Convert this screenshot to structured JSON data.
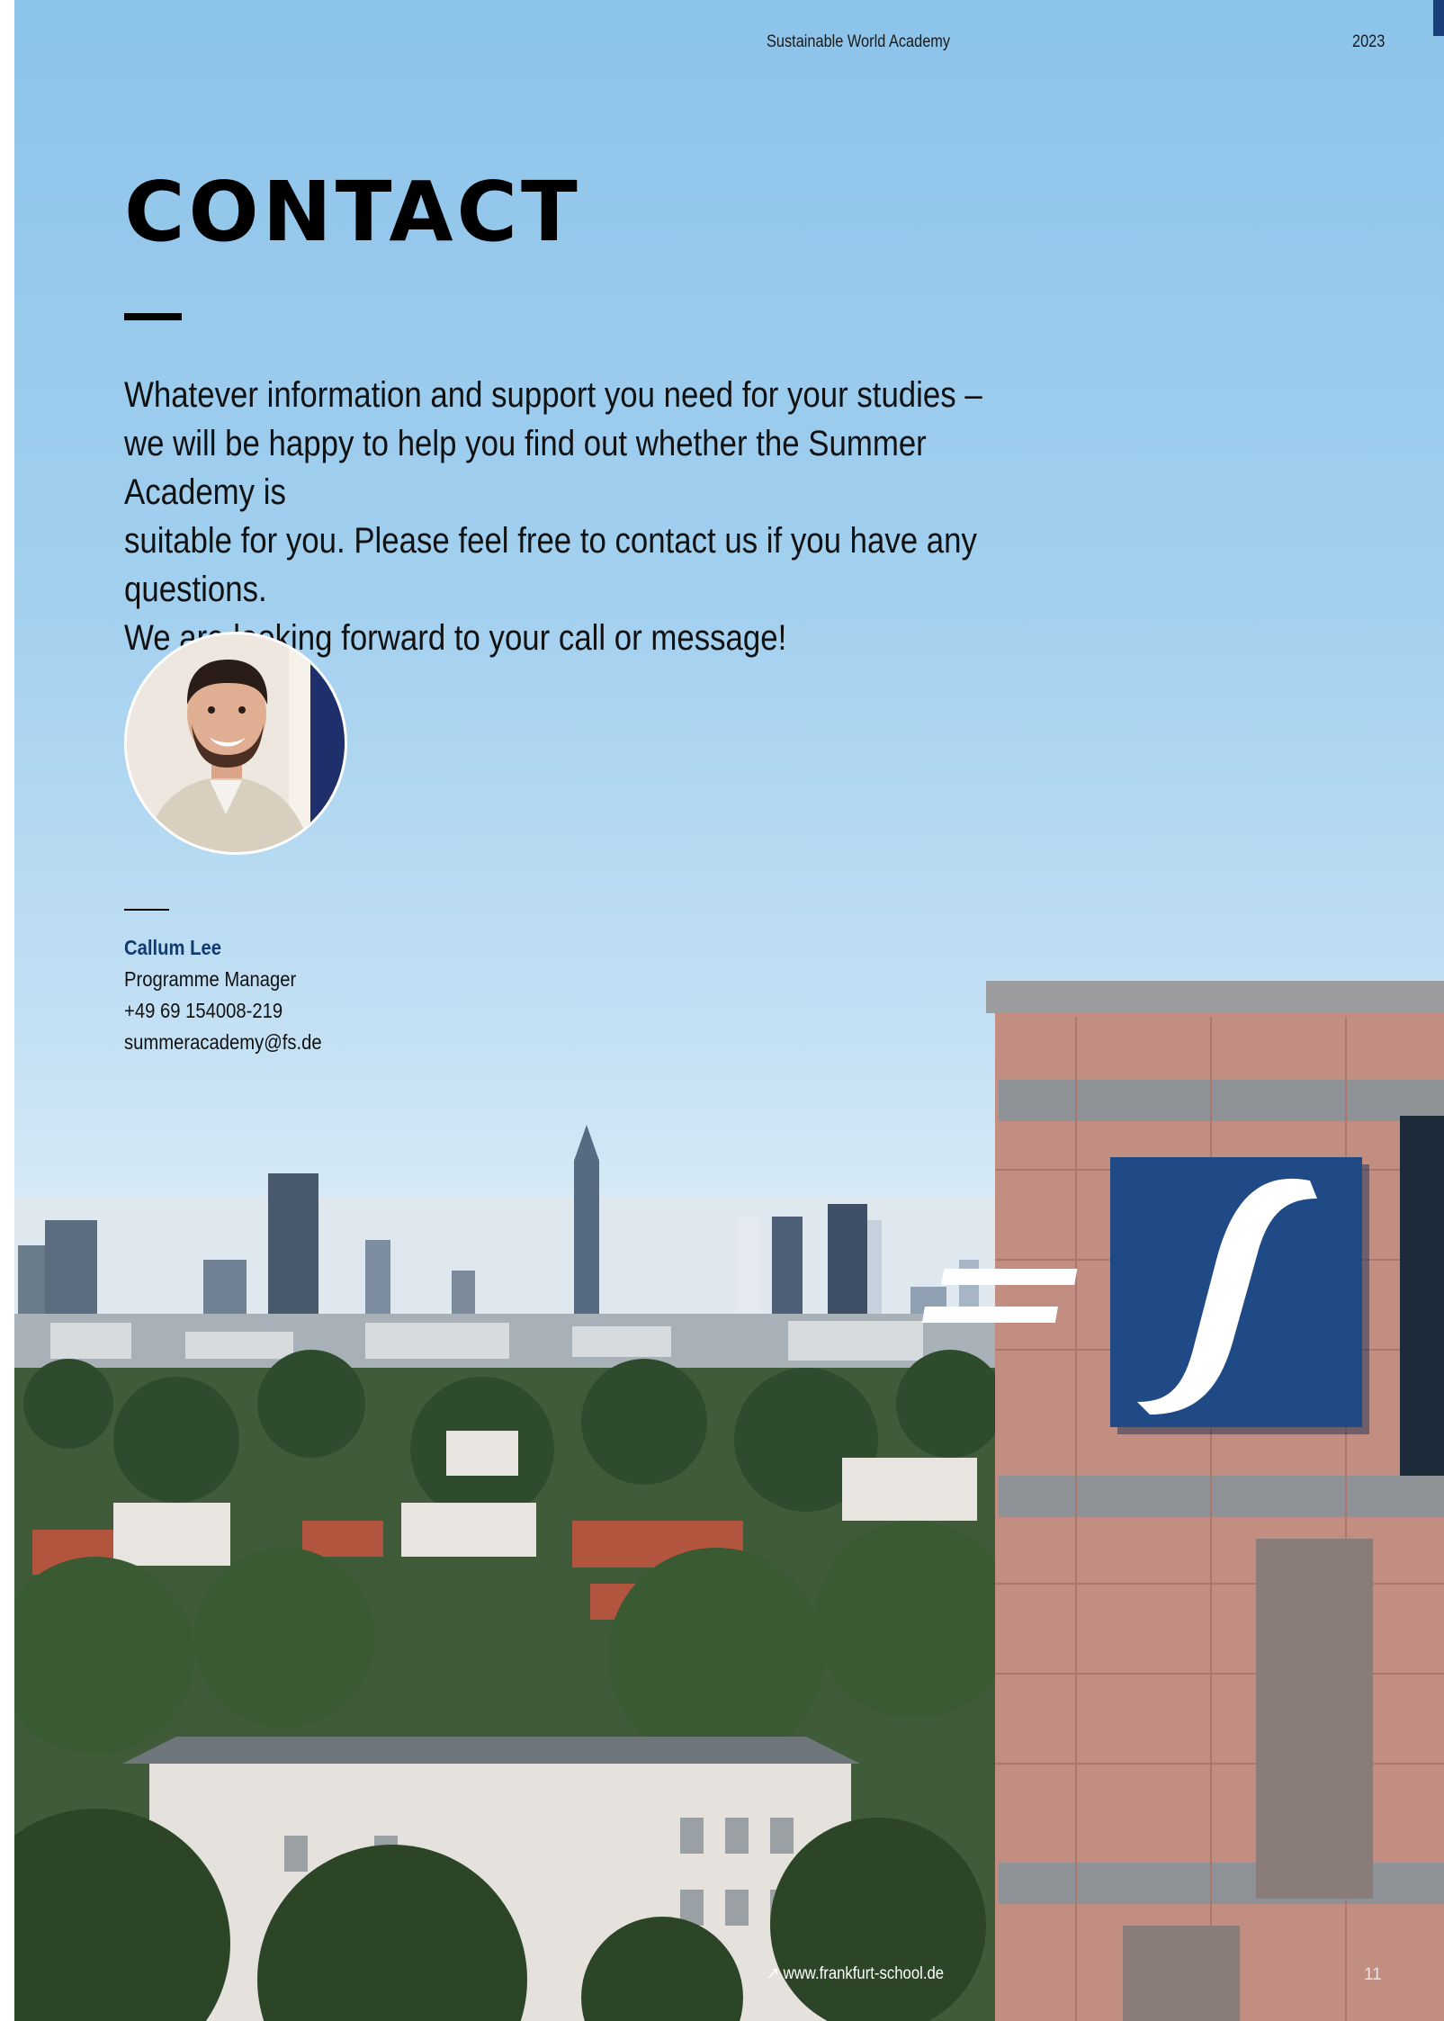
{
  "header": {
    "academy_name": "Sustainable World Academy",
    "year": "2023"
  },
  "main": {
    "title": "CONTACT",
    "intro_lines": [
      "Whatever information and support you need for your studies –",
      "we will be happy to help you find out whether the Summer Academy is",
      "suitable for you. Please feel free to contact us if you have any questions.",
      "We are looking forward to your call or message!"
    ]
  },
  "contact": {
    "name": "Callum Lee",
    "role": "Programme Manager",
    "phone": "+49 69 154008-219",
    "email": "summeracademy@fs.de"
  },
  "footer": {
    "link_icon": "arrow-up-right-icon",
    "link_text": "↗ www.frankfurt-school.de",
    "page_number": "11"
  },
  "logo": {
    "glyph": "f-logo-icon",
    "color": "#1f4a86"
  },
  "colors": {
    "accent": "#1b3f7a",
    "name": "#0f3a73"
  }
}
